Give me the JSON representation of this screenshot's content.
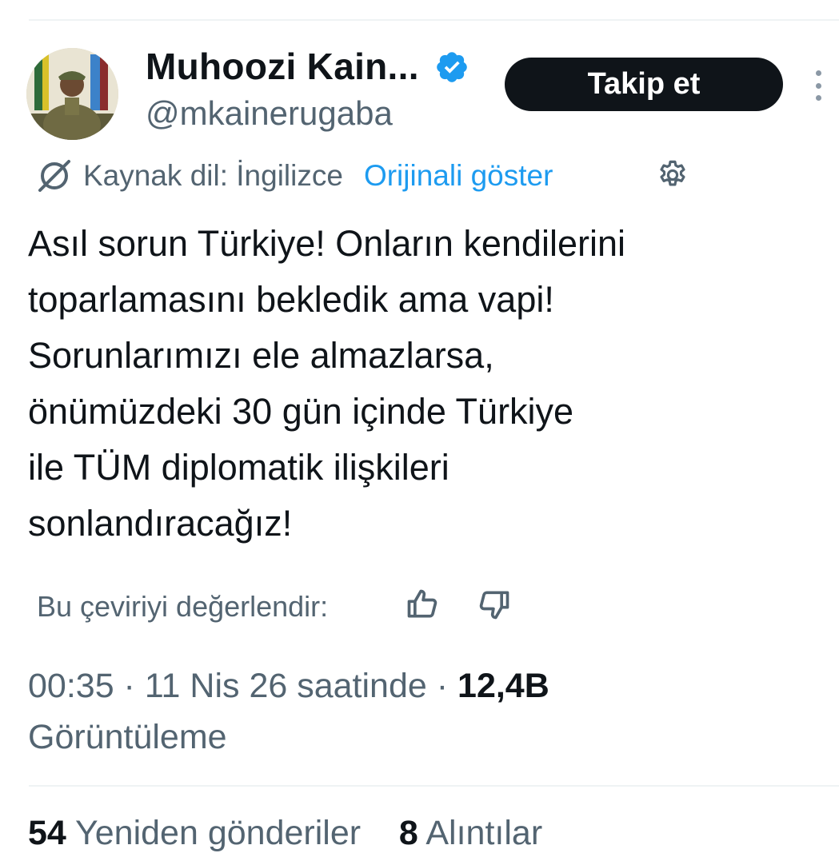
{
  "author": {
    "display_name": "Muhoozi Kain...",
    "handle": "@mkainerugaba",
    "verified": true
  },
  "actions": {
    "follow_label": "Takip et"
  },
  "translation": {
    "source_label": "Kaynak dil: İngilizce",
    "show_original_label": "Orijinali göster",
    "rate_label": "Bu çeviriyi değerlendir:"
  },
  "tweet": {
    "lines": [
      "Asıl sorun Türkiye! Onların kendilerini",
      "toparlamasını bekledik ama vapi!",
      "Sorunlarımızı ele almazlarsa,",
      "önümüzdeki 30 gün içinde Türkiye",
      "ile TÜM diplomatik ilişkileri",
      "sonlandıracağız!"
    ]
  },
  "meta": {
    "time_date": "00:35 · 11 Nis 26 saatinde · ",
    "views_count": "12,4B",
    "views_label": "Görüntüleme"
  },
  "stats": {
    "reposts_count": "54",
    "reposts_label": "Yeniden gönderiler",
    "quotes_count": "8",
    "quotes_label": "Alıntılar"
  },
  "colors": {
    "accent": "#1d9bf0",
    "text_primary": "#0f1419",
    "text_secondary": "#536471",
    "button_bg": "#0f1419"
  },
  "icons": [
    "avatar-photo",
    "verified-badge-icon",
    "more-options-icon",
    "translate-icon",
    "gear-icon",
    "thumbs-up-icon",
    "thumbs-down-icon"
  ]
}
